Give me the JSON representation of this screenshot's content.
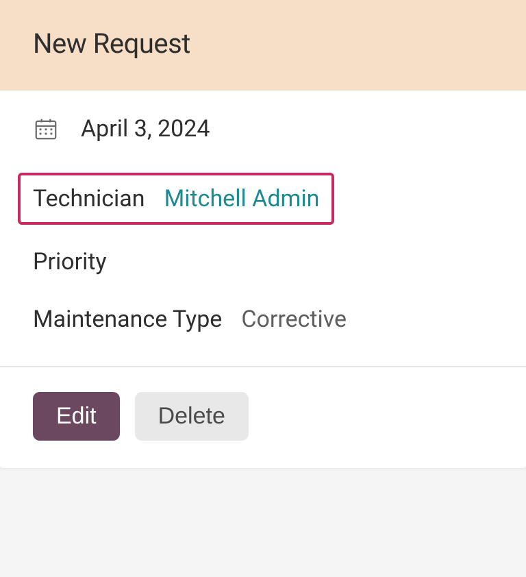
{
  "header": {
    "title": "New Request"
  },
  "details": {
    "date": "April 3, 2024",
    "technician_label": "Technician",
    "technician_value": "Mitchell Admin",
    "priority_label": "Priority",
    "maintenance_type_label": "Maintenance Type",
    "maintenance_type_value": "Corrective"
  },
  "actions": {
    "edit_label": "Edit",
    "delete_label": "Delete"
  }
}
